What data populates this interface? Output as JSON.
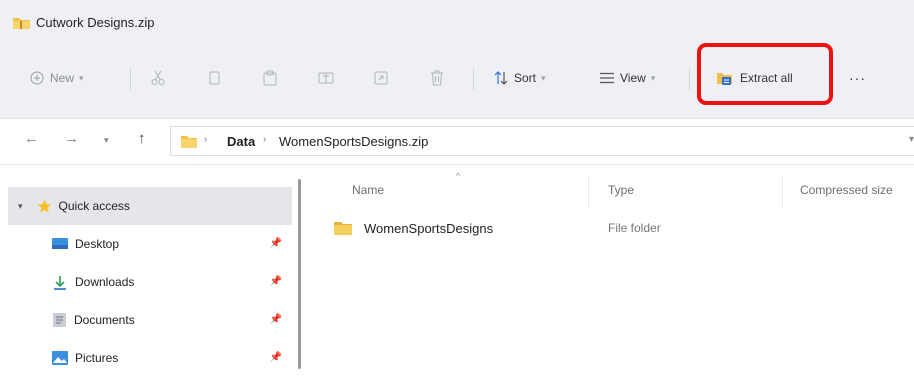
{
  "window": {
    "title": "Cutwork Designs.zip"
  },
  "toolbar": {
    "new_label": "New",
    "sort_label": "Sort",
    "view_label": "View",
    "extract_label": "Extract all",
    "more_label": "···",
    "highlight_color": "#ee1111"
  },
  "navigation": {
    "breadcrumb": [
      "Data",
      "WomenSportsDesigns.zip"
    ]
  },
  "sidebar": {
    "items": [
      {
        "label": "Quick access",
        "icon": "star-icon",
        "expanded": true
      },
      {
        "label": "Desktop",
        "icon": "desktop-icon",
        "pinned": true
      },
      {
        "label": "Downloads",
        "icon": "download-icon",
        "pinned": true
      },
      {
        "label": "Documents",
        "icon": "documents-icon",
        "pinned": true
      },
      {
        "label": "Pictures",
        "icon": "pictures-icon",
        "pinned": true
      }
    ]
  },
  "columns": {
    "name": "Name",
    "type": "Type",
    "compressed_size": "Compressed size"
  },
  "files": [
    {
      "name": "WomenSportsDesigns",
      "type": "File folder",
      "icon": "folder-icon"
    }
  ]
}
